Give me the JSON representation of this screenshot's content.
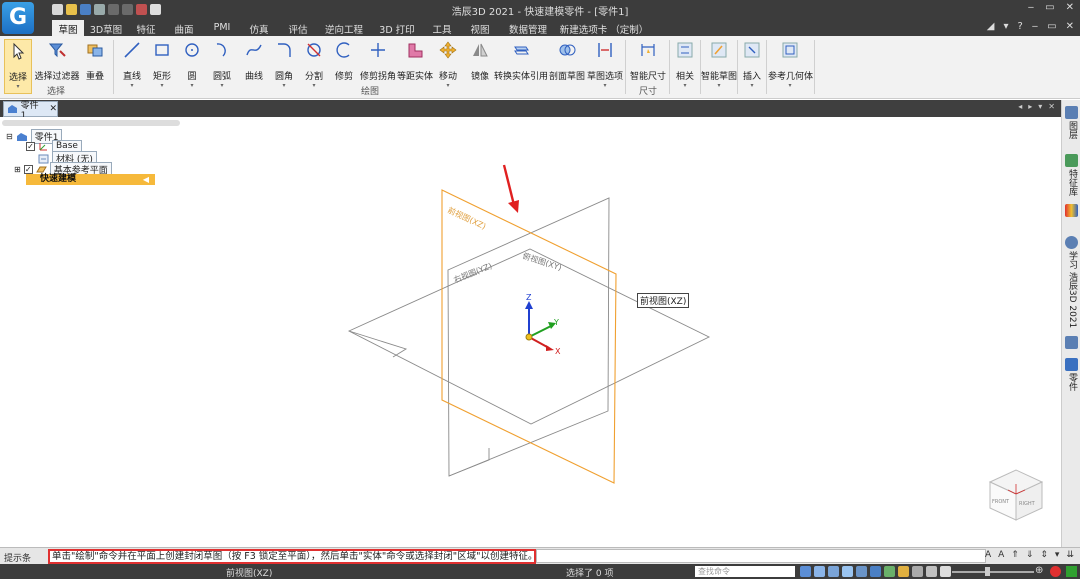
{
  "window": {
    "title": "浩辰3D 2021 - 快速建模零件 - [零件1]",
    "app_logo": "G",
    "controls": [
      "‒",
      "▭",
      "✕"
    ],
    "controls_row2": [
      "◢",
      "▾",
      "?",
      "‒",
      "▭",
      "✕"
    ]
  },
  "menu": {
    "tabs": [
      "草图",
      "3D草图",
      "特征",
      "曲面",
      "PMI",
      "仿真",
      "评估",
      "逆向工程",
      "3D 打印",
      "工具",
      "视图",
      "数据管理",
      "新建选项卡 （定制）"
    ]
  },
  "ribbon": {
    "buttons": [
      {
        "label": "选择",
        "icon": "cursor-icon"
      },
      {
        "label": "选择过滤器",
        "icon": "filter-icon"
      },
      {
        "label": "重叠",
        "icon": "overlap-icon"
      },
      {
        "label": "直线",
        "icon": "line-icon"
      },
      {
        "label": "矩形",
        "icon": "rectangle-icon"
      },
      {
        "label": "圆",
        "icon": "circle-icon"
      },
      {
        "label": "圆弧",
        "icon": "arc-icon"
      },
      {
        "label": "曲线",
        "icon": "curve-icon"
      },
      {
        "label": "圆角",
        "icon": "fillet-icon"
      },
      {
        "label": "分割",
        "icon": "split-icon"
      },
      {
        "label": "修剪",
        "icon": "trim-icon"
      },
      {
        "label": "修剪拐角",
        "icon": "trim-corner-icon"
      },
      {
        "label": "等距实体",
        "icon": "offset-icon"
      },
      {
        "label": "移动",
        "icon": "move-icon"
      },
      {
        "label": "镜像",
        "icon": "mirror-icon"
      },
      {
        "label": "转换实体引用",
        "icon": "convert-entities-icon"
      },
      {
        "label": "剖面草图",
        "icon": "section-sketch-icon"
      },
      {
        "label": "草图选项",
        "icon": "sketch-options-icon"
      },
      {
        "label": "智能尺寸",
        "icon": "smart-dimension-icon"
      },
      {
        "label": "相关",
        "icon": "relations-icon"
      },
      {
        "label": "智能草图",
        "icon": "smart-sketch-icon"
      },
      {
        "label": "插入",
        "icon": "insert-icon"
      },
      {
        "label": "参考几何体",
        "icon": "reference-geometry-icon"
      }
    ],
    "groups": {
      "select": "选择",
      "draw": "绘图",
      "dimension": "尺寸"
    }
  },
  "doc_tab": {
    "label": "零件1",
    "close": "✕"
  },
  "tab_controls": [
    "◂",
    "▸",
    "▾",
    "✕"
  ],
  "tree": {
    "root": "零件1",
    "base": "Base",
    "material": "材料 (无)",
    "ref_planes": "基本参考平面",
    "quick_model": "快速建模"
  },
  "viewport": {
    "plane_front": "前视图(XZ)",
    "plane_right": "右视图(YZ)",
    "plane_top": "俯视图(XY)",
    "front_tag": "前视图(XZ)",
    "axis_x": "X",
    "axis_y": "Y",
    "axis_z": "Z",
    "cube_front": "FRONT",
    "cube_right": "RIGHT"
  },
  "right_panel": {
    "items": [
      "图层",
      "特征库",
      "学习 浩辰3D 2021",
      "零件"
    ]
  },
  "prompt": {
    "label": "提示条",
    "text": "单击\"绘制\"命令并在平面上创建封闭草图（按 F3 锁定至平面），然后单击\"实体\"命令或选择封闭\"区域\"以创建特征。",
    "controls": [
      "A",
      "A",
      "⇑",
      "⇓",
      "⇕",
      "▾",
      "⇊"
    ]
  },
  "status": {
    "view": "前视图(XZ)",
    "selection": "选择了 0 项",
    "search_placeholder": "查找命令"
  },
  "colors": {
    "accent": "#f6b93b",
    "front_plane": "#f0a030",
    "plane_line": "#777777",
    "annotation": "#e03030",
    "axis_x": "#d02020",
    "axis_y": "#20a020",
    "axis_z": "#2040d0"
  }
}
